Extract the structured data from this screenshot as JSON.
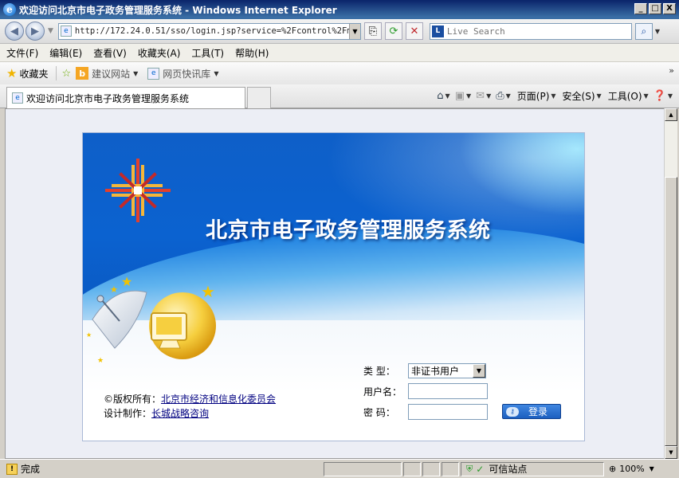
{
  "window": {
    "title": "欢迎访问北京市电子政务管理服务系统 - Windows Internet Explorer",
    "minimize": "_",
    "maximize": "□",
    "close": "X"
  },
  "address": {
    "url": "http://172.24.0.51/sso/login.jsp?service=%2Fcontrol%2Fma",
    "search_placeholder": "Live Search"
  },
  "menu": {
    "items": [
      "文件(F)",
      "编辑(E)",
      "查看(V)",
      "收藏夹(A)",
      "工具(T)",
      "帮助(H)"
    ]
  },
  "favorites": {
    "label": "收藏夹",
    "links": [
      "建议网站",
      "网页快讯库"
    ]
  },
  "tab": {
    "label": "欢迎访问北京市电子政务管理服务系统"
  },
  "commandbar": {
    "page": "页面(P)",
    "safety": "安全(S)",
    "tools": "工具(O)"
  },
  "login": {
    "system_title": "北京市电子政务管理服务系统",
    "type_label": "类  型：",
    "type_value": "非证书用户",
    "username_label": "用户名：",
    "username_value": "",
    "password_label": "密  码：",
    "password_value": "",
    "submit_label": "登录",
    "copyright_prefix": "©版权所有：",
    "copyright_owner": "北京市经济和信息化委员会",
    "designer_prefix": "设计制作：",
    "designer_name": "长城战略咨询"
  },
  "status": {
    "text": "完成",
    "zone": "可信站点",
    "zoom": "100%"
  },
  "colors": {
    "banner_blue": "#0b62d0",
    "title_bar": "#0a246a",
    "link": "#000080"
  }
}
